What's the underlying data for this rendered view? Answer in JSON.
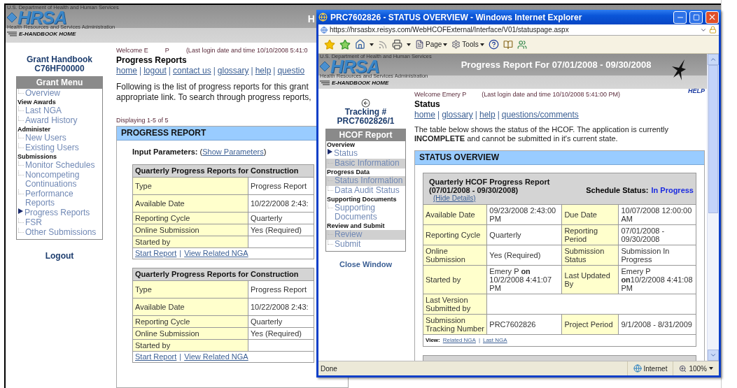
{
  "background_page": {
    "header": {
      "agency": "U.S. Department of Health and Human Services",
      "logo": "HRSA",
      "subtitle": "Health Resources and Services Administration",
      "home_link": "E-HANDBOOK HOME",
      "title": "H"
    },
    "sidebar": {
      "title": "Grant Handbook",
      "grant_number": "C76HF00000",
      "menu_title": "Grant Menu",
      "logout": "Logout",
      "items": [
        {
          "kind": "link",
          "label": "Overview",
          "selected": false
        },
        {
          "kind": "section",
          "label": "View Awards"
        },
        {
          "kind": "link",
          "label": "Last NGA",
          "selected": false
        },
        {
          "kind": "link",
          "label": "Award History",
          "selected": false
        },
        {
          "kind": "section",
          "label": "Administer"
        },
        {
          "kind": "link",
          "label": "New Users",
          "selected": false
        },
        {
          "kind": "link",
          "label": "Existing Users",
          "selected": false
        },
        {
          "kind": "section",
          "label": "Submissions"
        },
        {
          "kind": "link",
          "label": "Monitor Schedules",
          "selected": false
        },
        {
          "kind": "link",
          "label": "Noncompeting Continuations",
          "selected": false
        },
        {
          "kind": "link",
          "label": "Performance Reports",
          "selected": false
        },
        {
          "kind": "link",
          "label": "Progress Reports",
          "selected": true
        },
        {
          "kind": "link",
          "label": "FSR",
          "selected": false
        },
        {
          "kind": "link",
          "label": "Other Submissions",
          "selected": false
        }
      ]
    },
    "welcome": "Welcome E",
    "user": "P",
    "last_login": "(Last login date and time 10/10/2008 5:41:0",
    "page_title": "Progress Reports",
    "nav": {
      "separator": "|",
      "links": [
        "home",
        "logout",
        "contact us",
        "glossary",
        "help",
        "questio"
      ]
    },
    "intro_lines": [
      "Following is the list of progress reports for this grant",
      "appropriate link. To search through progress reports,"
    ],
    "displaying": "Displaying 1-5 of 5",
    "panel_title": "PROGRESS REPORT",
    "input_parameters": {
      "label": "Input Parameters:",
      "link_prefix": "(",
      "link": "Show Parameters",
      "link_suffix": ")"
    },
    "reports": [
      {
        "title": "Quarterly Progress Reports for Construction",
        "rows": [
          {
            "label": "Type",
            "value": "Progress Report"
          },
          {
            "label": "Available Date",
            "value": "10/22/2008 2:43:"
          },
          {
            "label": "Reporting Cycle",
            "value": "Quarterly"
          },
          {
            "label": "Online Submission",
            "value": "Yes (Required)"
          },
          {
            "label": "Started by"
          }
        ],
        "separator": "|",
        "links": [
          "Start Report",
          "View Related NGA"
        ]
      },
      {
        "title": "Quarterly Progress Reports for Construction",
        "rows": [
          {
            "label": "Type",
            "value": "Progress Report"
          },
          {
            "label": "Available Date",
            "value": "10/22/2008 2:43:"
          },
          {
            "label": "Reporting Cycle",
            "value": "Quarterly"
          },
          {
            "label": "Online Submission",
            "value": "Yes (Required)"
          },
          {
            "label": "Started by"
          }
        ],
        "separator": "|",
        "links": [
          "Start Report",
          "View Related NGA"
        ]
      }
    ]
  },
  "popup": {
    "title": "PRC7602826 - STATUS OVERVIEW - Windows Internet Explorer",
    "address": "https://hrsasbx.reisys.com/WebHCOFExternal/Interface/V01/statuspage.aspx",
    "toolbar_labels": [
      "Page",
      "Tools"
    ],
    "page": {
      "header": {
        "agency": "U.S. Department of Health and Human Services",
        "logo": "HRSA",
        "subtitle": "Health Resources and Services Administration",
        "home_link": "E-HANDBOOK HOME",
        "title": "Progress Report For 07/01/2008 - 09/30/2008"
      },
      "help": "HELP",
      "sidebar": {
        "tracking_label": "Tracking #",
        "tracking_number": "PRC7602826/1",
        "menu_title": "HCOF Report",
        "close": "Close Window",
        "items": [
          {
            "kind": "section",
            "label": "Overview"
          },
          {
            "kind": "link",
            "label": "Status",
            "selected": true,
            "shaded": false
          },
          {
            "kind": "link",
            "label": "Basic Information",
            "selected": false,
            "shaded": true
          },
          {
            "kind": "section",
            "label": "Progress Data"
          },
          {
            "kind": "link",
            "label": "Status Information",
            "selected": false,
            "shaded": true
          },
          {
            "kind": "link",
            "label": "Data Audit Status",
            "selected": false,
            "shaded": false
          },
          {
            "kind": "section",
            "label": "Supporting Documents"
          },
          {
            "kind": "link",
            "label": "Supporting Documents",
            "selected": false,
            "shaded": false
          },
          {
            "kind": "section",
            "label": "Review and Submit"
          },
          {
            "kind": "link",
            "label": "Review",
            "selected": false,
            "shaded": true
          },
          {
            "kind": "link",
            "label": "Submit",
            "selected": false,
            "shaded": false
          }
        ]
      },
      "welcome": "Welcome Emery P",
      "last_login": "(Last login date and time 10/10/2008 5:41:00 PM)",
      "page_title": "Status",
      "nav": {
        "separator": "|",
        "links": [
          "home",
          "glossary",
          "help",
          "questions/comments"
        ]
      },
      "intro": "The table below shows the status of the HCOF. The application is currently **INCOMPLETE** and cannot be submitted in it's current state.",
      "panel_title": "STATUS OVERVIEW",
      "report": {
        "title": "Quarterly HCOF Progress Report",
        "period": "(07/01/2008 - 09/30/2008)",
        "hide_link": "(Hide Details)",
        "schedule_label": "Schedule Status:",
        "schedule_value": "In Progress",
        "rows": [
          {
            "cells": [
              {
                "label": "Available Date",
                "value": "09/23/2008 2:43:00 PM"
              },
              {
                "label": "Due Date",
                "value": "10/07/2008 12:00:00 AM"
              }
            ]
          },
          {
            "cells": [
              {
                "label": "Reporting Cycle",
                "value": "Quarterly"
              },
              {
                "label": "Reporting Period",
                "value": "07/01/2008 - 09/30/2008"
              }
            ]
          },
          {
            "cells": [
              {
                "label": "Online Submission",
                "value": "Yes (Required)"
              },
              {
                "label": "Submission Status",
                "value": "Submission In Progress"
              }
            ]
          },
          {
            "cells": [
              {
                "label": "Started by",
                "value": "Emery P **on** 10/2/2008 4:41:07 PM"
              },
              {
                "label": "Last Updated By",
                "value": "Emery P **on**10/2/2008 4:41:08 PM"
              }
            ]
          },
          {
            "cells": [
              {
                "label": "Last Version Submitted by"
              }
            ]
          },
          {
            "cells": [
              {
                "label": "Submission Tracking Number",
                "value": "PRC7602826"
              },
              {
                "label": "Project Period",
                "value": "9/1/2008 - 8/31/2009"
              }
            ]
          }
        ],
        "view_label": "View:",
        "view_separator": "|",
        "view_links": [
          "Related NGA",
          "Last NGA"
        ]
      }
    },
    "status_bar": {
      "text": "Done",
      "zone": "Internet",
      "zoom": "100%"
    }
  }
}
